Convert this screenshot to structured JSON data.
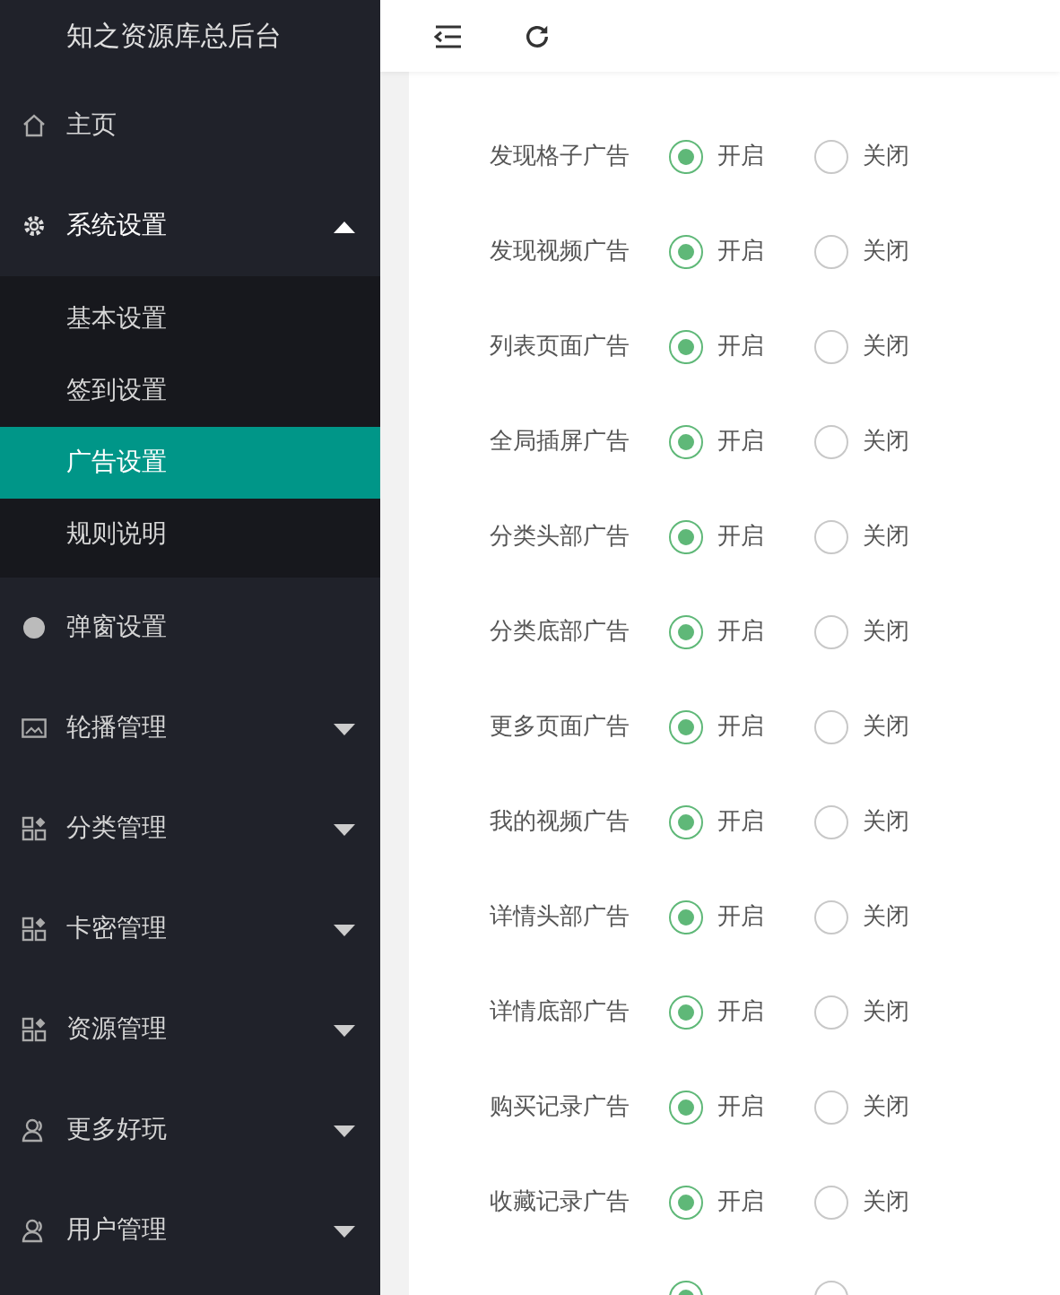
{
  "sidebar": {
    "title": "知之资源库总后台",
    "items": [
      {
        "kind": "home",
        "label": "主页"
      },
      {
        "kind": "gear",
        "label": "系统设置",
        "expanded": true,
        "children": [
          {
            "label": "基本设置",
            "selected": false
          },
          {
            "label": "签到设置",
            "selected": false
          },
          {
            "label": "广告设置",
            "selected": true
          },
          {
            "label": "规则说明",
            "selected": false
          }
        ]
      },
      {
        "kind": "dot",
        "label": "弹窗设置"
      },
      {
        "kind": "image",
        "label": "轮播管理",
        "expanded": false
      },
      {
        "kind": "grid",
        "label": "分类管理",
        "expanded": false
      },
      {
        "kind": "grid",
        "label": "卡密管理",
        "expanded": false
      },
      {
        "kind": "grid",
        "label": "资源管理",
        "expanded": false
      },
      {
        "kind": "user",
        "label": "更多好玩",
        "expanded": false
      },
      {
        "kind": "user",
        "label": "用户管理",
        "expanded": false
      }
    ]
  },
  "settings": [
    {
      "label": "发现格子广告",
      "options": [
        {
          "label": "开启",
          "selected": true
        },
        {
          "label": "关闭",
          "selected": false
        }
      ]
    },
    {
      "label": "发现视频广告",
      "options": [
        {
          "label": "开启",
          "selected": true
        },
        {
          "label": "关闭",
          "selected": false
        }
      ]
    },
    {
      "label": "列表页面广告",
      "options": [
        {
          "label": "开启",
          "selected": true
        },
        {
          "label": "关闭",
          "selected": false
        }
      ]
    },
    {
      "label": "全局插屏广告",
      "options": [
        {
          "label": "开启",
          "selected": true
        },
        {
          "label": "关闭",
          "selected": false
        }
      ]
    },
    {
      "label": "分类头部广告",
      "options": [
        {
          "label": "开启",
          "selected": true
        },
        {
          "label": "关闭",
          "selected": false
        }
      ]
    },
    {
      "label": "分类底部广告",
      "options": [
        {
          "label": "开启",
          "selected": true
        },
        {
          "label": "关闭",
          "selected": false
        }
      ]
    },
    {
      "label": "更多页面广告",
      "options": [
        {
          "label": "开启",
          "selected": true
        },
        {
          "label": "关闭",
          "selected": false
        }
      ]
    },
    {
      "label": "我的视频广告",
      "options": [
        {
          "label": "开启",
          "selected": true
        },
        {
          "label": "关闭",
          "selected": false
        }
      ]
    },
    {
      "label": "详情头部广告",
      "options": [
        {
          "label": "开启",
          "selected": true
        },
        {
          "label": "关闭",
          "selected": false
        }
      ]
    },
    {
      "label": "详情底部广告",
      "options": [
        {
          "label": "开启",
          "selected": true
        },
        {
          "label": "关闭",
          "selected": false
        }
      ]
    },
    {
      "label": "购买记录广告",
      "options": [
        {
          "label": "开启",
          "selected": true
        },
        {
          "label": "关闭",
          "selected": false
        }
      ]
    },
    {
      "label": "收藏记录广告",
      "options": [
        {
          "label": "开启",
          "selected": true
        },
        {
          "label": "关闭",
          "selected": false
        }
      ]
    },
    {
      "options": [
        {
          "selected": true
        },
        {
          "selected": false
        }
      ]
    }
  ]
}
